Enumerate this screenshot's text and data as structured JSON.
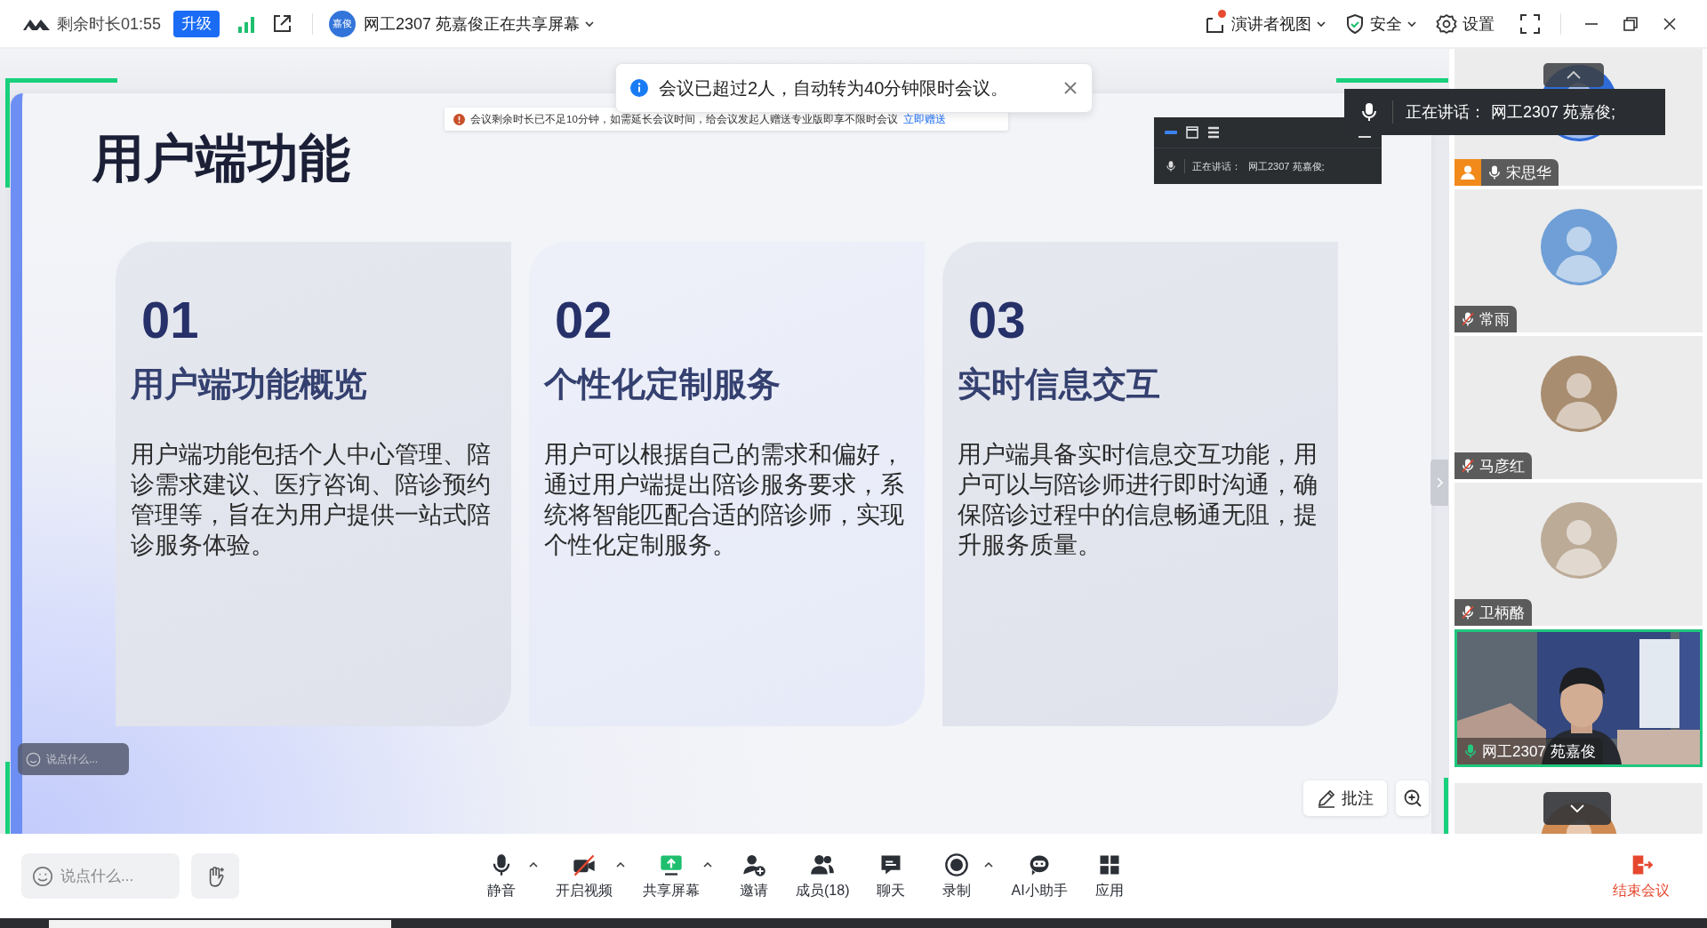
{
  "top_bar": {
    "remaining_time": "剩余时长01:55",
    "upgrade": "升级",
    "sharer_avatar": "嘉俊",
    "sharer_status": "网工2307 苑嘉俊正在共享屏幕",
    "presenter_view": {
      "label": "演讲者视图",
      "badge": true
    },
    "security": "安全",
    "settings": "设置"
  },
  "notification": {
    "message": "会议已超过2人，自动转为40分钟限时会议。"
  },
  "banner": {
    "message": "会议剩余时长已不足10分钟，如需延长会议时间，给会议发起人赠送专业版即享不限时会议",
    "link": "立即赠送"
  },
  "mini_window": {
    "label": "正在讲话：",
    "speakers": "网工2307 苑嘉俊;"
  },
  "speaking_tooltip": {
    "label": "正在讲话：",
    "speakers": "网工2307 苑嘉俊;"
  },
  "slide": {
    "title": "用户端功能",
    "cards": [
      {
        "number": "01",
        "title": "用户端功能概览",
        "body": "用户端功能包括个人中心管理、陪诊需求建议、医疗咨询、陪诊预约管理等，旨在为用户提供一站式陪诊服务体验。"
      },
      {
        "number": "02",
        "title": "个性化定制服务",
        "body": "用户可以根据自己的需求和偏好，通过用户端提出陪诊服务要求，系统将智能匹配合适的陪诊师，实现个性化定制服务。"
      },
      {
        "number": "03",
        "title": "实时信息交互",
        "body": "用户端具备实时信息交互功能，用户可以与陪诊师进行即时沟通，确保陪诊过程中的信息畅通无阻，提升服务质量。"
      }
    ]
  },
  "slide_chat": {
    "placeholder": "说点什么..."
  },
  "annotate": {
    "label": "批注"
  },
  "participants": [
    {
      "name": "宋思华",
      "kind": "avatar",
      "host": true,
      "muted": false,
      "speaking": false,
      "highlighted": false
    },
    {
      "name": "常雨",
      "kind": "avatar",
      "host": false,
      "muted": true,
      "speaking": false,
      "highlighted": false
    },
    {
      "name": "马彦红",
      "kind": "avatar",
      "host": false,
      "muted": true,
      "speaking": false,
      "highlighted": false
    },
    {
      "name": "卫柄酪",
      "kind": "avatar",
      "host": false,
      "muted": true,
      "speaking": false,
      "highlighted": false
    },
    {
      "name": "网工2307 苑嘉俊",
      "kind": "video",
      "host": false,
      "muted": false,
      "speaking": true,
      "highlighted": true
    },
    {
      "kind": "avatar",
      "highlighted": false
    }
  ],
  "toolbar": {
    "chat_placeholder": "说点什么...",
    "items": [
      {
        "label": "静音",
        "kind": "mic",
        "menu": true
      },
      {
        "label": "开启视频",
        "kind": "camera-off",
        "menu": true
      },
      {
        "label": "共享屏幕",
        "kind": "share",
        "menu": true
      },
      {
        "label": "邀请",
        "kind": "invite",
        "menu": false
      },
      {
        "label": "成员(18)",
        "kind": "members",
        "menu": false
      },
      {
        "label": "聊天",
        "kind": "chat",
        "menu": false
      },
      {
        "label": "录制",
        "kind": "record",
        "menu": true
      },
      {
        "label": "AI小助手",
        "kind": "assistant",
        "menu": false
      },
      {
        "label": "应用",
        "kind": "apps",
        "menu": false
      }
    ],
    "end": "结束会议"
  }
}
